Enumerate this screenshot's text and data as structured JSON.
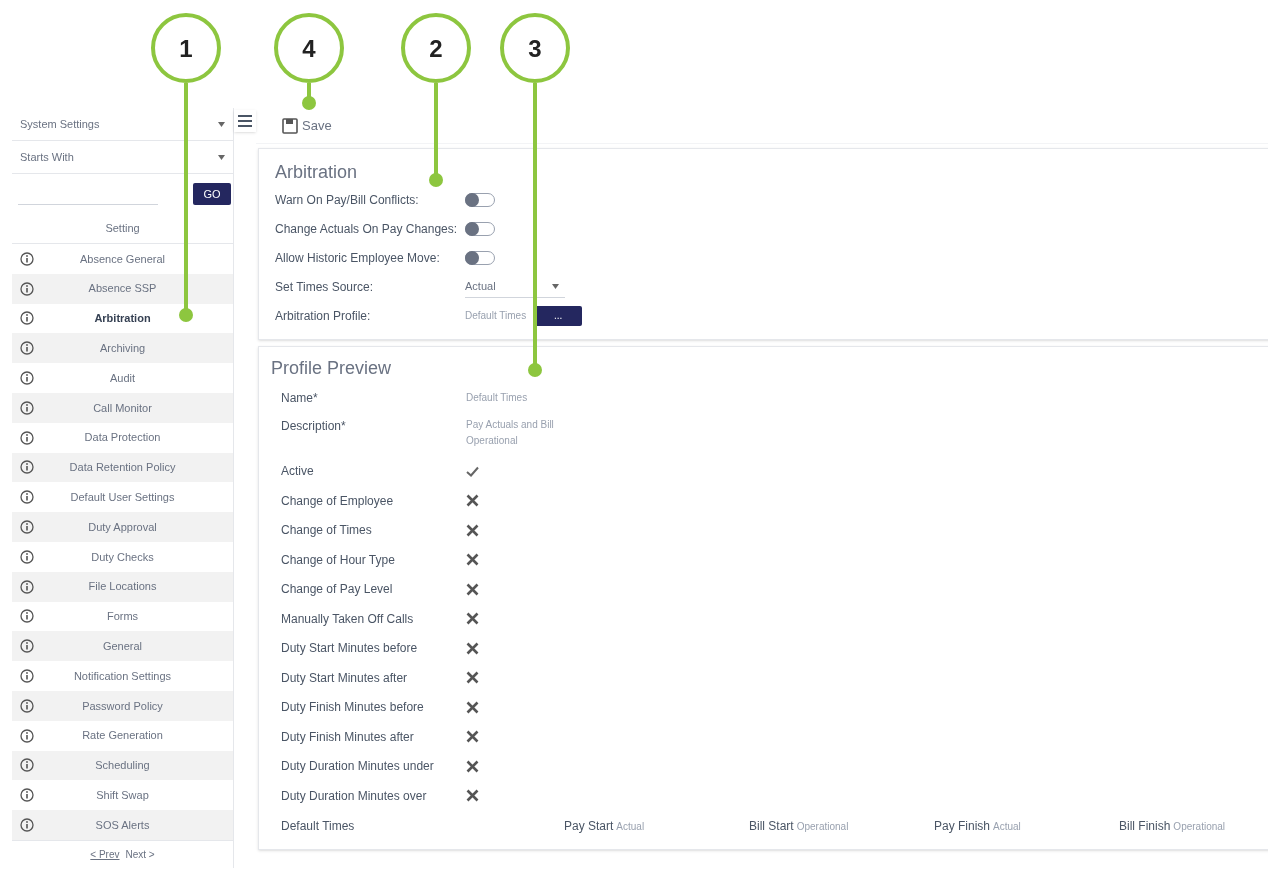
{
  "callouts": [
    {
      "number": "1"
    },
    {
      "number": "4"
    },
    {
      "number": "2"
    },
    {
      "number": "3"
    }
  ],
  "sidebar": {
    "category_dropdown": "System Settings",
    "filter_dropdown": "Starts With",
    "go_button": "GO",
    "column_header": "Setting",
    "items": [
      {
        "label": "Absence General",
        "selected": false
      },
      {
        "label": "Absence SSP",
        "selected": false
      },
      {
        "label": "Arbitration",
        "selected": true
      },
      {
        "label": "Archiving",
        "selected": false
      },
      {
        "label": "Audit",
        "selected": false
      },
      {
        "label": "Call Monitor",
        "selected": false
      },
      {
        "label": "Data Protection",
        "selected": false
      },
      {
        "label": "Data Retention Policy",
        "selected": false
      },
      {
        "label": "Default User Settings",
        "selected": false
      },
      {
        "label": "Duty Approval",
        "selected": false
      },
      {
        "label": "Duty Checks",
        "selected": false
      },
      {
        "label": "File Locations",
        "selected": false
      },
      {
        "label": "Forms",
        "selected": false
      },
      {
        "label": "General",
        "selected": false
      },
      {
        "label": "Notification Settings",
        "selected": false
      },
      {
        "label": "Password Policy",
        "selected": false
      },
      {
        "label": "Rate Generation",
        "selected": false
      },
      {
        "label": "Scheduling",
        "selected": false
      },
      {
        "label": "Shift Swap",
        "selected": false
      },
      {
        "label": "SOS Alerts",
        "selected": false
      }
    ],
    "pager": {
      "prev": "< Prev",
      "next": "Next >"
    }
  },
  "toolbar": {
    "save": "Save"
  },
  "arbitration": {
    "title": "Arbitration",
    "settings": [
      {
        "kind": "toggle",
        "label": "Warn On Pay/Bill Conflicts:",
        "on": false
      },
      {
        "kind": "toggle",
        "label": "Change Actuals On Pay Changes:",
        "on": false
      },
      {
        "kind": "toggle",
        "label": "Allow Historic Employee Move:",
        "on": false
      },
      {
        "kind": "select",
        "label": "Set Times Source:",
        "value": "Actual"
      },
      {
        "kind": "profile",
        "label": "Arbitration Profile:",
        "value": "Default Times",
        "button": "..."
      }
    ]
  },
  "profile_preview": {
    "title": "Profile Preview",
    "fields": [
      {
        "kind": "text",
        "label": "Name*",
        "value": "Default Times"
      },
      {
        "kind": "text",
        "label": "Description*",
        "value": "Pay Actuals and Bill Operational"
      },
      {
        "kind": "flag",
        "label": "Active",
        "checked": true
      },
      {
        "kind": "flag",
        "label": "Change of Employee",
        "checked": false
      },
      {
        "kind": "flag",
        "label": "Change of Times",
        "checked": false
      },
      {
        "kind": "flag",
        "label": "Change of Hour Type",
        "checked": false
      },
      {
        "kind": "flag",
        "label": "Change of Pay Level",
        "checked": false
      },
      {
        "kind": "flag",
        "label": "Manually Taken Off Calls",
        "checked": false
      },
      {
        "kind": "flag",
        "label": "Duty Start Minutes before",
        "checked": false
      },
      {
        "kind": "flag",
        "label": "Duty Start Minutes after",
        "checked": false
      },
      {
        "kind": "flag",
        "label": "Duty Finish Minutes before",
        "checked": false
      },
      {
        "kind": "flag",
        "label": "Duty Finish Minutes after",
        "checked": false
      },
      {
        "kind": "flag",
        "label": "Duty Duration Minutes under",
        "checked": false
      },
      {
        "kind": "flag",
        "label": "Duty Duration Minutes over",
        "checked": false
      }
    ],
    "default_times": {
      "label": "Default Times",
      "items": [
        {
          "label": "Pay Start",
          "value": "Actual"
        },
        {
          "label": "Bill Start",
          "value": "Operational"
        },
        {
          "label": "Pay Finish",
          "value": "Actual"
        },
        {
          "label": "Bill Finish",
          "value": "Operational"
        }
      ]
    }
  }
}
